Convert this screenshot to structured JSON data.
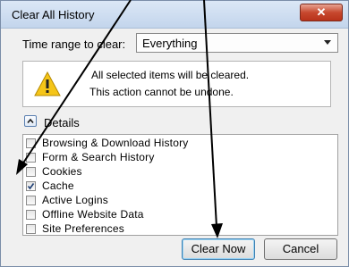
{
  "dialog": {
    "title": "Clear All History",
    "close_glyph": "✕",
    "time_range_label": "Time range to clear:",
    "time_range_value": "Everything",
    "warning_line1": "All selected items will be cleared.",
    "warning_line2": "This action cannot be undone.",
    "details_label": "Details",
    "items": [
      {
        "label": "Browsing & Download History",
        "checked": false
      },
      {
        "label": "Form & Search History",
        "checked": false
      },
      {
        "label": "Cookies",
        "checked": false
      },
      {
        "label": "Cache",
        "checked": true
      },
      {
        "label": "Active Logins",
        "checked": false
      },
      {
        "label": "Offline Website Data",
        "checked": false
      },
      {
        "label": "Site Preferences",
        "checked": false
      }
    ],
    "clear_now_label": "Clear Now",
    "cancel_label": "Cancel"
  },
  "icons": {
    "warning": "warning-triangle-icon",
    "details_toggle": "chevron-up-icon",
    "close": "close-icon"
  },
  "colors": {
    "warning_yellow": "#f5c518",
    "close_red": "#c7482e",
    "annotation_black": "#000000"
  }
}
